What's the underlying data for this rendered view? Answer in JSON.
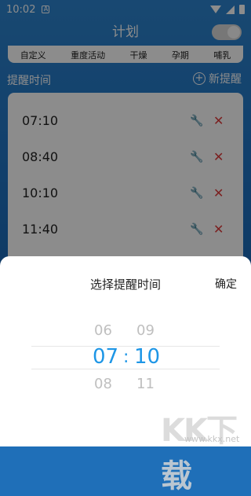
{
  "status_bar": {
    "time": "10:02"
  },
  "header": {
    "title": "计划"
  },
  "categories": [
    "自定义",
    "重度活动",
    "干燥",
    "孕期",
    "哺乳"
  ],
  "section": {
    "title": "提醒时间",
    "add_label": "新提醒"
  },
  "reminders": [
    {
      "time": "07:10"
    },
    {
      "time": "08:40"
    },
    {
      "time": "10:10"
    },
    {
      "time": "11:40"
    }
  ],
  "picker": {
    "title": "选择提醒时间",
    "confirm_label": "确定",
    "hours": {
      "prev": "06",
      "selected": "07",
      "next": "08"
    },
    "minutes": {
      "prev": "09",
      "selected": "10",
      "next": "11"
    },
    "separator": ":"
  },
  "watermark": {
    "text": "KK下载",
    "url": "www.kkx.net"
  },
  "colors": {
    "accent": "#1e96e6",
    "delete": "#e03b3b"
  }
}
